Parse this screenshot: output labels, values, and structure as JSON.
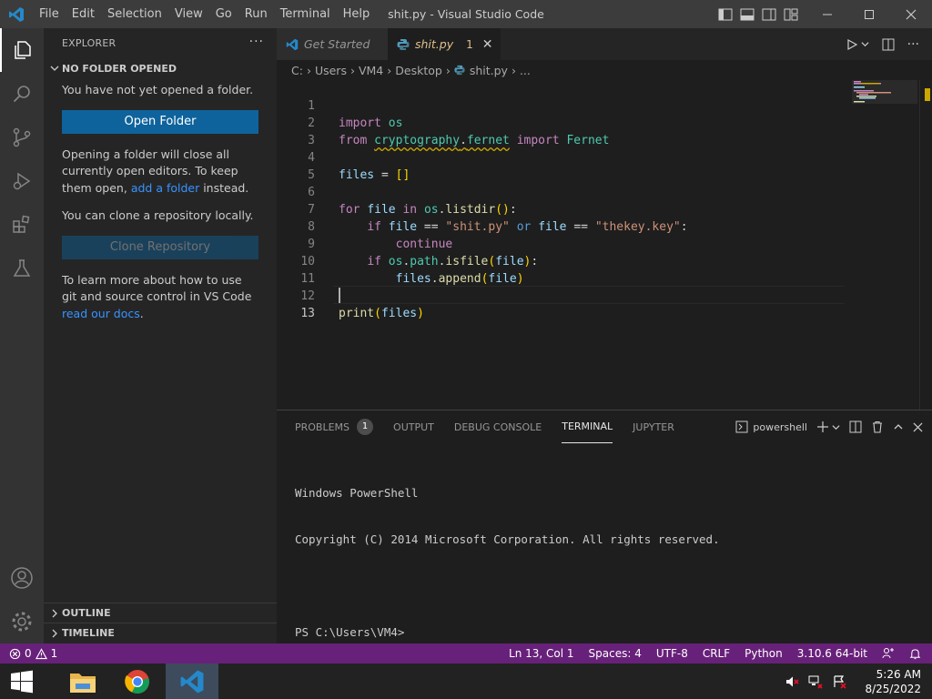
{
  "titlebar": {
    "title": "shit.py - Visual Studio Code",
    "menu": [
      "File",
      "Edit",
      "Selection",
      "View",
      "Go",
      "Run",
      "Terminal",
      "Help"
    ]
  },
  "sidebar": {
    "header": "EXPLORER",
    "more": "···",
    "section_title": "NO FOLDER OPENED",
    "msg_no_folder": "You have not yet opened a folder.",
    "open_folder_label": "Open Folder",
    "msg_opening_1": "Opening a folder will close all currently open editors. To keep them open, ",
    "msg_opening_link": "add a folder",
    "msg_opening_2": " instead.",
    "msg_clone": "You can clone a repository locally.",
    "clone_label": "Clone Repository",
    "msg_git_1": "To learn more about how to use git and source control in VS Code ",
    "msg_git_link": "read our docs",
    "msg_git_2": ".",
    "outline_label": "OUTLINE",
    "timeline_label": "TIMELINE"
  },
  "tabs": [
    {
      "label": "Get Started"
    },
    {
      "label": "shit.py",
      "problems": "1",
      "close": "✕"
    }
  ],
  "breadcrumb": [
    "C:",
    "Users",
    "VM4",
    "Desktop",
    "shit.py",
    "..."
  ],
  "editor": {
    "line_numbers": [
      "1",
      "2",
      "3",
      "4",
      "5",
      "6",
      "7",
      "8",
      "9",
      "10",
      "11",
      "12",
      "13"
    ],
    "code": [
      "import os",
      "from cryptography.fernet import Fernet",
      "",
      "files = []",
      "",
      "for file in os.listdir():",
      "    if file == \"shit.py\" or file == \"thekey.key\":",
      "        continue",
      "    if os.path.isfile(file):",
      "        files.append(file)",
      "",
      "print(files)",
      ""
    ]
  },
  "panel": {
    "tabs": [
      "PROBLEMS",
      "OUTPUT",
      "DEBUG CONSOLE",
      "TERMINAL",
      "JUPYTER"
    ],
    "problems_count": "1",
    "shell_label": "powershell",
    "terminal_lines": [
      "Windows PowerShell",
      "Copyright (C) 2014 Microsoft Corporation. All rights reserved.",
      "",
      "PS C:\\Users\\VM4>"
    ]
  },
  "statusbar": {
    "errors": "0",
    "warnings": "1",
    "position": "Ln 13, Col 1",
    "spaces": "Spaces: 4",
    "encoding": "UTF-8",
    "eol": "CRLF",
    "language": "Python",
    "interpreter": "3.10.6 64-bit"
  },
  "taskbar": {
    "time": "5:26 AM",
    "date": "8/25/2022"
  },
  "colors": {
    "statusbar": "#68217a",
    "accent_blue": "#0e639c",
    "link": "#3794ff",
    "warning": "#cca700"
  },
  "icons": [
    "vscode-logo-icon",
    "explorer-icon",
    "search-icon",
    "source-control-icon",
    "run-debug-icon",
    "extensions-icon",
    "testing-icon",
    "account-icon",
    "manage-gear-icon",
    "python-file-icon",
    "run-icon",
    "split-editor-icon",
    "windows-start-icon",
    "file-explorer-icon",
    "chrome-icon"
  ]
}
